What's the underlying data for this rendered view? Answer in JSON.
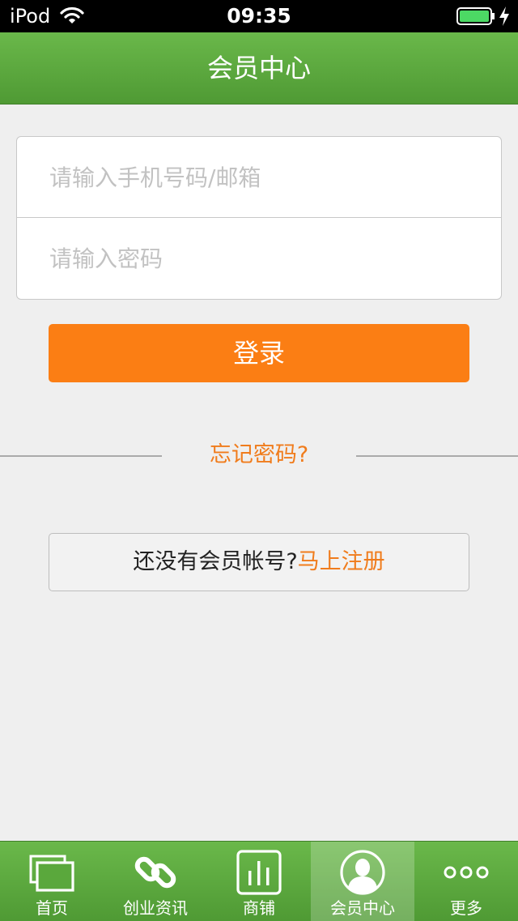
{
  "status_bar": {
    "carrier": "iPod",
    "time": "09:35"
  },
  "header": {
    "title": "会员中心"
  },
  "login_form": {
    "phone_placeholder": "请输入手机号码/邮箱",
    "password_placeholder": "请输入密码",
    "login_label": "登录"
  },
  "forgot_password": {
    "label": "忘记密码?"
  },
  "register": {
    "prompt": "还没有会员帐号?",
    "link_label": "马上注册"
  },
  "tab_bar": {
    "items": [
      {
        "label": "首页",
        "icon": "windows-icon"
      },
      {
        "label": "创业资讯",
        "icon": "link-icon"
      },
      {
        "label": "商铺",
        "icon": "bar-chart-icon"
      },
      {
        "label": "会员中心",
        "icon": "user-icon",
        "active": true
      },
      {
        "label": "更多",
        "icon": "more-dots-icon"
      }
    ]
  },
  "colors": {
    "primary_green": "#5aa83c",
    "accent_orange": "#fb7e14",
    "background": "#efefef"
  }
}
